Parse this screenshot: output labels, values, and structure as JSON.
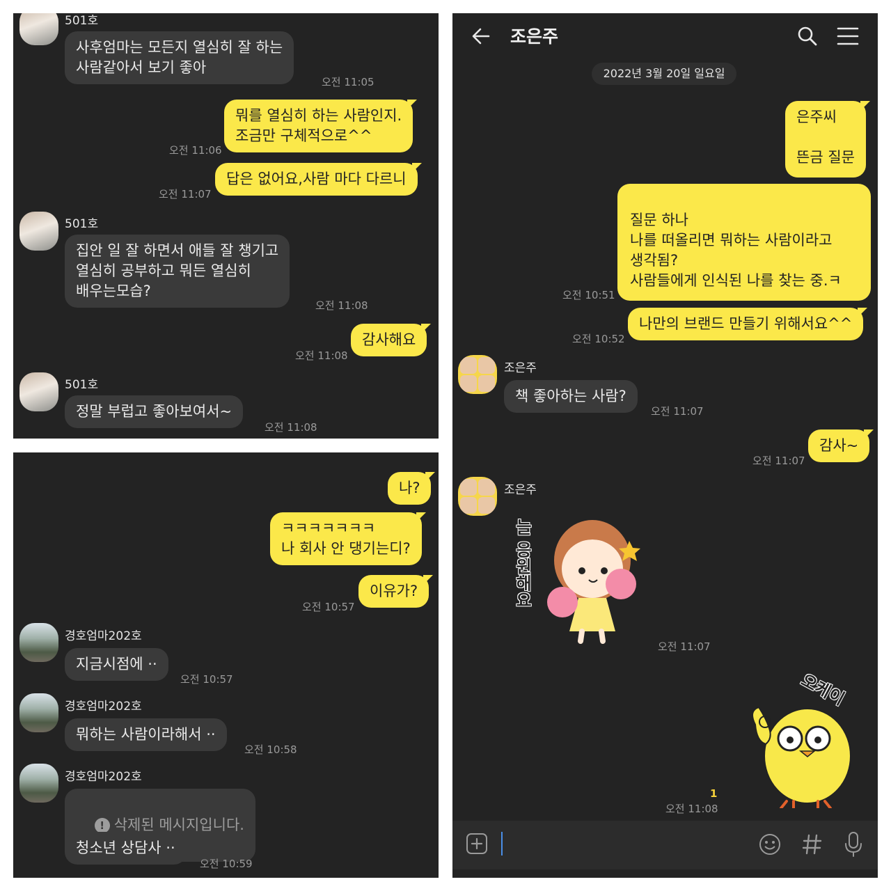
{
  "panel1": {
    "top_name_partial": "501호",
    "messages": [
      {
        "text": "사후엄마는 모든지 열심히 잘 하는\n사람같아서 보기 좋아",
        "time": "오전 11:05"
      },
      {
        "text": "뭐를 열심히 하는 사람인지.\n조금만 구체적으로^^",
        "time": "오전 11:06"
      },
      {
        "text": "답은 없어요,사람 마다 다르니",
        "time": "오전 11:07"
      },
      {
        "name": "501호",
        "text": "집안 일 잘 하면서 애들 잘 챙기고\n열심히 공부하고 뭐든 열심히\n배우는모습?",
        "time": "오전 11:08"
      },
      {
        "text": "감사해요",
        "time": "오전 11:08"
      },
      {
        "name": "501호",
        "text": "정말 부럽고 좋아보여서~",
        "time": "오전 11:08"
      }
    ]
  },
  "panel2": {
    "messages": [
      {
        "text": "나?"
      },
      {
        "text": "ㅋㅋㅋㅋㅋㅋㅋ\n나 회사 안 댕기는디?"
      },
      {
        "text": "이유가?",
        "time": "오전 10:57"
      },
      {
        "name": "경호엄마202호",
        "text": "지금시점에 ··",
        "time": "오전 10:57"
      },
      {
        "name": "경호엄마202호",
        "text": "뭐하는 사람이라해서 ··",
        "time": "오전 10:58"
      },
      {
        "name": "경호엄마202호",
        "deleted_text": "삭제된 메시지입니다.",
        "deleted_icon": "!"
      },
      {
        "text": "청소년 상담사 ··",
        "time": "오전 10:59"
      }
    ]
  },
  "panel3": {
    "header": {
      "title": "조은주"
    },
    "date_divider": "2022년 3월 20일 일요일",
    "messages": [
      {
        "text": "은주씨\n\n뜬금 질문"
      },
      {
        "text": "질문 하나\n나를 떠올리면 뭐하는 사람이라고\n생각됨?\n사람들에게 인식된 나를 찾는 중.ㅋ",
        "time": "오전 10:51"
      },
      {
        "text": "나만의 브랜드 만들기 위해서요^^",
        "time": "오전 10:52"
      },
      {
        "name": "조은주",
        "text": "책 좋아하는 사람?",
        "time": "오전 11:07"
      },
      {
        "text": "감사~",
        "time": "오전 11:07"
      },
      {
        "name": "조은주",
        "sticker_text": "늘 응원해요",
        "time": "오전 11:07"
      },
      {
        "sticker_text": "오케이",
        "unread": "1",
        "time": "오전 11:08"
      }
    ]
  },
  "icons": [
    "back-arrow-icon",
    "search-icon",
    "menu-icon",
    "plus-icon",
    "emoji-icon",
    "hashtag-icon",
    "mic-icon"
  ],
  "colors": {
    "bubble_out": "#fbe84a",
    "bubble_in": "#3a3a3a",
    "background": "#232323"
  }
}
